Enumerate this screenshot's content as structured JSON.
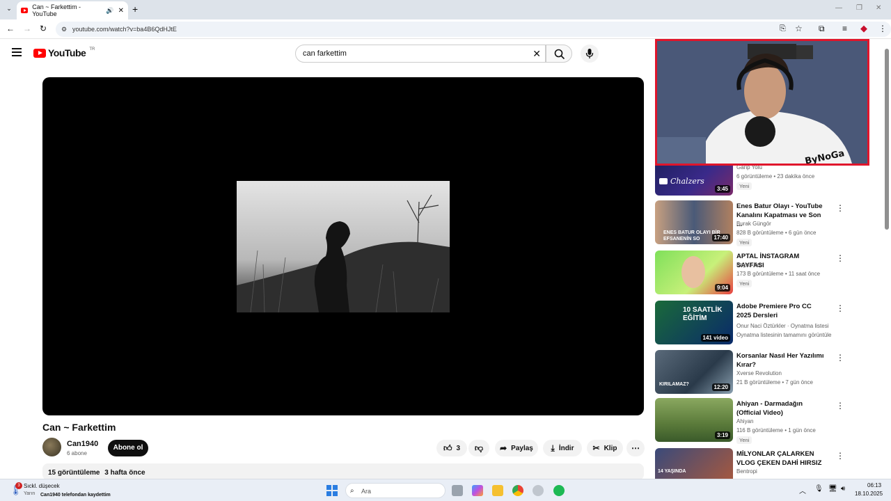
{
  "browser": {
    "tab_title": "Can ~ Farkettim - YouTube",
    "url": "youtube.com/watch?v=ba4B6QdHJtE"
  },
  "youtube": {
    "logo_text": "YouTube",
    "region": "TR",
    "search_value": "can farkettim"
  },
  "video": {
    "title": "Can ~ Farkettim",
    "channel": "Can1940",
    "subscribers": "6 abone",
    "subscribe_label": "Abone ol",
    "likes": "3",
    "share_label": "Paylaş",
    "download_label": "İndir",
    "clip_label": "Klip",
    "views": "15 görüntüleme",
    "age": "3 hafta önce"
  },
  "webcam": {
    "brand_text": "ByNoGa"
  },
  "recommendations": [
    {
      "title": "",
      "channel": "Garip Yolu",
      "meta": "6 görüntüleme • 23 dakika önce",
      "badge": "Yeni",
      "duration": "3:45",
      "thumb_text": "Chalzers"
    },
    {
      "title": "Enes Batur Olayı - YouTube Kanalını Kapatması ve Son ...",
      "channel": "Burak Güngör",
      "meta": "828 B görüntüleme • 6 gün önce",
      "badge": "Yeni",
      "duration": "17:40",
      "thumb_text": "ENES BATUR OLAYI BİR EFSANENİN SO"
    },
    {
      "title": "APTAL İNSTAGRAM SAYFASI",
      "channel": "Beyaz Kurt",
      "meta": "173 B görüntüleme • 11 saat önce",
      "badge": "Yeni",
      "duration": "9:04",
      "thumb_text": ""
    },
    {
      "title": "Adobe Premiere Pro CC 2025 Dersleri",
      "channel": "Onur Naci Öztürkler",
      "channel_extra": "Oynatma listesi",
      "meta": "Oynatma listesinin tamamını görüntüle",
      "badge": "",
      "duration": "141 video",
      "thumb_text": "10 SAATLİK EĞİTİM"
    },
    {
      "title": "Korsanlar Nasıl Her Yazılımı Kırar?",
      "channel": "Xverse Revolution",
      "meta": "21 B görüntüleme • 7 gün önce",
      "badge": "",
      "duration": "12:20",
      "thumb_text": "KIRILAMAZ?"
    },
    {
      "title": "Ahiyan - Darmadağın (Official Video)",
      "channel": "Ahiyan",
      "meta": "116 B görüntüleme • 1 gün önce",
      "badge": "Yeni",
      "duration": "3:19",
      "thumb_text": ""
    },
    {
      "title": "MİLYONLAR ÇALARKEN VLOG ÇEKEN DAHİ HIRSIZ",
      "channel": "Bentropi",
      "meta": "",
      "badge": "",
      "duration": "",
      "thumb_text": "14 YAŞINDA"
    }
  ],
  "taskbar": {
    "weather_text": "Sıckl. düşecek",
    "weather_sub": "Yarın",
    "weather_badge": "3",
    "notification": "Can1940 telefondan kaydettim",
    "search_placeholder": "Ara",
    "time": "06:13",
    "date": "18.10.2025"
  },
  "colors": {
    "youtube_red": "#ff0000",
    "webcam_border": "#e0152b"
  }
}
